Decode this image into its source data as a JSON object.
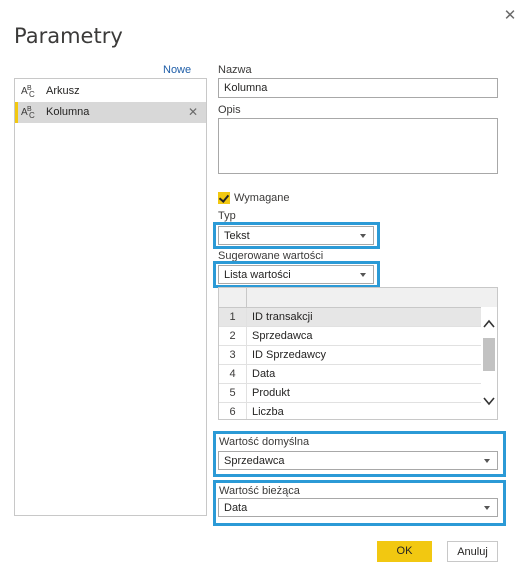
{
  "dialog": {
    "title": "Parametry",
    "close_icon": "close-icon"
  },
  "sidebar": {
    "new_label": "Nowe",
    "items": [
      {
        "label": "Arkusz",
        "icon": "abc-text-icon",
        "selected": false
      },
      {
        "label": "Kolumna",
        "icon": "abc-text-icon",
        "selected": true
      }
    ]
  },
  "form": {
    "name_label": "Nazwa",
    "name_value": "Kolumna",
    "description_label": "Opis",
    "description_value": "",
    "required_label": "Wymagane",
    "required_checked": true,
    "type_label": "Typ",
    "type_value": "Tekst",
    "suggested_label": "Sugerowane wartości",
    "suggested_value": "Lista wartości",
    "values_list": [
      {
        "n": "1",
        "value": "ID transakcji"
      },
      {
        "n": "2",
        "value": "Sprzedawca"
      },
      {
        "n": "3",
        "value": "ID Sprzedawcy"
      },
      {
        "n": "4",
        "value": "Data"
      },
      {
        "n": "5",
        "value": "Produkt"
      },
      {
        "n": "6",
        "value": "Liczba"
      }
    ],
    "default_label": "Wartość domyślna",
    "default_value": "Sprzedawca",
    "current_label": "Wartość bieżąca",
    "current_value": "Data"
  },
  "buttons": {
    "ok_label": "OK",
    "cancel_label": "Anuluj"
  },
  "colors": {
    "accent": "#f2c811",
    "highlight": "#2b9ad6",
    "link": "#1f5ea8"
  }
}
